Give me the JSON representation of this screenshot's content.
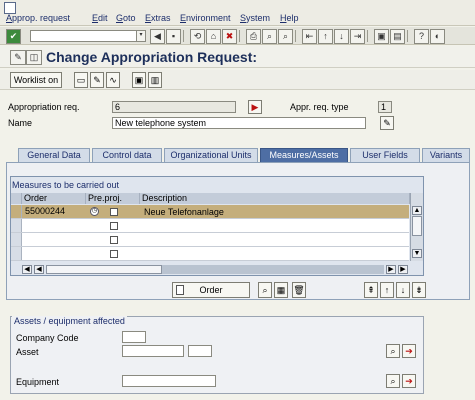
{
  "menu": {
    "items": [
      "Approp. request",
      "Edit",
      "Goto",
      "Extras",
      "Environment",
      "System",
      "Help"
    ]
  },
  "toolbar": {
    "command_value": ""
  },
  "page": {
    "title": "Change Appropriation Request:"
  },
  "app_toolbar": {
    "worklist_label": "Worklist on"
  },
  "header_fields": {
    "approp_req_label": "Appropriation req.",
    "approp_req_value": "6",
    "approp_req_type_label": "Appr. req. type",
    "approp_req_type_value": "1",
    "name_label": "Name",
    "name_value": "New telephone system"
  },
  "tabs": [
    "General Data",
    "Control data",
    "Organizational Units",
    "Measures/Assets",
    "User Fields",
    "Variants"
  ],
  "active_tab": "Measures/Assets",
  "measures_table": {
    "caption": "Measures to be carried out",
    "columns": [
      "Order",
      "Pre.proj.",
      "Description"
    ],
    "rows": [
      {
        "order": "55000244",
        "description": "Neue Telefonanlage"
      },
      {
        "order": "",
        "description": ""
      },
      {
        "order": "",
        "description": ""
      },
      {
        "order": "",
        "description": ""
      }
    ]
  },
  "table_actions": {
    "order_label": "Order"
  },
  "assets_section": {
    "caption": "Assets / equipment affected",
    "company_code_label": "Company Code",
    "asset_label": "Asset",
    "equipment_label": "Equipment"
  },
  "colors": {
    "accent": "#4e6ea4",
    "selected_row": "#c4ae7c",
    "title": "#1d2f5a"
  }
}
